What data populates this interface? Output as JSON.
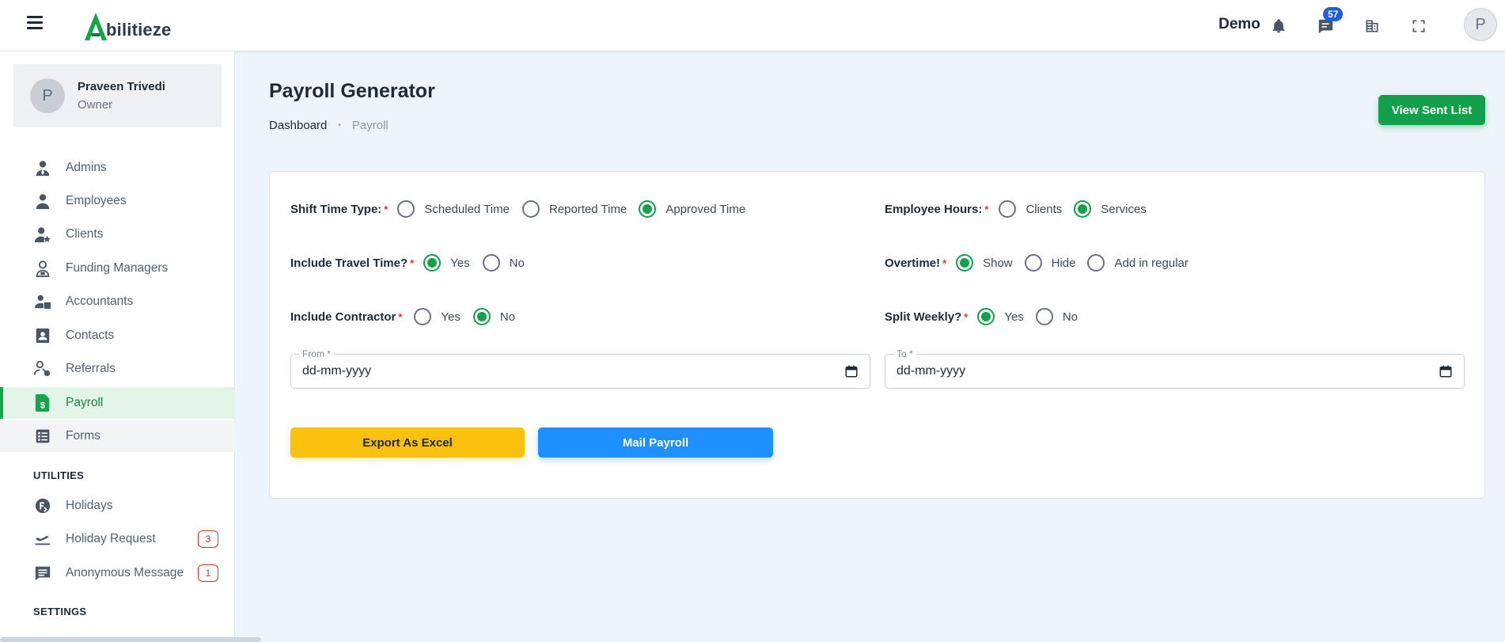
{
  "header": {
    "logo_text": "bilitieze",
    "user_label": "Demo",
    "messages_count": "57",
    "avatar_letter": "P"
  },
  "profile": {
    "avatar_letter": "P",
    "name": "Praveen Trivedi",
    "role": "Owner"
  },
  "nav": [
    {
      "label": "Admins",
      "icon": "admin-icon"
    },
    {
      "label": "Employees",
      "icon": "employee-icon"
    },
    {
      "label": "Clients",
      "icon": "client-icon"
    },
    {
      "label": "Funding Managers",
      "icon": "funding-manager-icon"
    },
    {
      "label": "Accountants",
      "icon": "accountant-icon"
    },
    {
      "label": "Contacts",
      "icon": "contacts-icon"
    },
    {
      "label": "Referrals",
      "icon": "referrals-icon"
    },
    {
      "label": "Payroll",
      "icon": "payroll-icon"
    },
    {
      "label": "Forms",
      "icon": "forms-icon"
    }
  ],
  "utilities": {
    "title": "UTILITIES",
    "items": [
      {
        "label": "Holidays",
        "icon": "holidays-icon"
      },
      {
        "label": "Holiday Request",
        "icon": "plane-icon",
        "badge": "3"
      },
      {
        "label": "Anonymous Message",
        "icon": "message-icon",
        "badge": "1"
      }
    ]
  },
  "settings": {
    "title": "SETTINGS"
  },
  "page": {
    "title": "Payroll Generator",
    "breadcrumb_home": "Dashboard",
    "breadcrumb_sep": "•",
    "breadcrumb_current": "Payroll",
    "view_sent_label": "View Sent List"
  },
  "form": {
    "shift_time_type": {
      "label": "Shift Time Type:",
      "options": [
        "Scheduled Time",
        "Reported Time",
        "Approved Time"
      ],
      "selected": "Approved Time"
    },
    "employee_hours": {
      "label": "Employee Hours:",
      "options": [
        "Clients",
        "Services"
      ],
      "selected": "Services"
    },
    "include_travel": {
      "label": "Include Travel Time?",
      "options": [
        "Yes",
        "No"
      ],
      "selected": "Yes"
    },
    "overtime": {
      "label": "Overtime!",
      "options": [
        "Show",
        "Hide",
        "Add in regular"
      ],
      "selected": "Show"
    },
    "include_contractor": {
      "label": "Include Contractor",
      "options": [
        "Yes",
        "No"
      ],
      "selected": "No"
    },
    "split_weekly": {
      "label": "Split Weekly?",
      "options": [
        "Yes",
        "No"
      ],
      "selected": "Yes"
    },
    "required_mark": "*",
    "from": {
      "legend": "From *",
      "value": "dd-mm-yyyy"
    },
    "to": {
      "legend": "To *",
      "value": "dd-mm-yyyy"
    },
    "export_label": "Export As Excel",
    "mail_label": "Mail Payroll"
  },
  "colors": {
    "brand_green": "#13a04a",
    "accent_yellow": "#fcc10f",
    "accent_blue": "#1e90ff",
    "badge_red": "#e03131"
  }
}
